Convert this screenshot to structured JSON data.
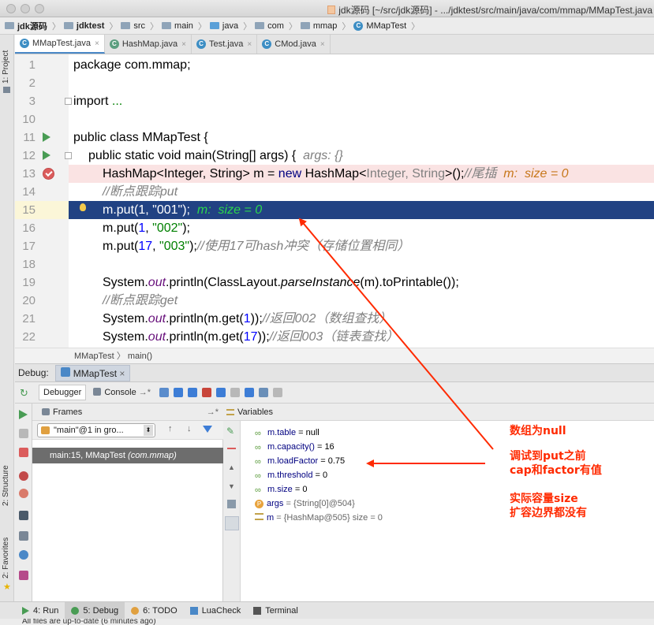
{
  "window": {
    "title": "jdk源码 [~/src/jdk源码] - .../jdktest/src/main/java/com/mmap/MMapTest.java"
  },
  "breadcrumb": {
    "items": [
      "jdk源码",
      "jdktest",
      "src",
      "main",
      "java",
      "com",
      "mmap",
      "MMapTest"
    ]
  },
  "left_stripe": {
    "project": "1: Project",
    "structure": "2: Structure",
    "favorites": "2: Favorites"
  },
  "tabs": [
    {
      "label": "MMapTest.java",
      "active": true
    },
    {
      "label": "HashMap.java",
      "active": false
    },
    {
      "label": "Test.java",
      "active": false
    },
    {
      "label": "CMod.java",
      "active": false
    }
  ],
  "editor": {
    "line_numbers": [
      "1",
      "2",
      "3",
      "10",
      "11",
      "12",
      "13",
      "14",
      "15",
      "16",
      "17",
      "18",
      "19",
      "20",
      "21",
      "22"
    ],
    "l1": "package com.mmap;",
    "l3a": "import ",
    "l3b": "...",
    "l11": "public class MMapTest {",
    "l12a": "public static void main(String[] args) {",
    "l12b": "args: {}",
    "l13a": "HashMap<Integer, String> m = ",
    "l13b": "new ",
    "l13c": "HashMap<",
    "l13d": "Integer, String",
    "l13e": ">();",
    "l13f": "//尾插",
    "l13g": "m:",
    "l13h": "size = 0",
    "l14": "//断点跟踪put",
    "l15a": "m.put(1, \"001\");",
    "l15b": "m:  size = 0",
    "l16a": "m.put(",
    "l16b": "1",
    "l16c": ", ",
    "l16d": "\"002\"",
    "l16e": ");",
    "l17a": "m.put(",
    "l17b": "17",
    "l17c": ", ",
    "l17d": "\"003\"",
    "l17e": ");",
    "l17f": "//使用17可hash冲突（存储位置相同）",
    "l19a": "System.",
    "l19b": "out",
    "l19c": ".println(ClassLayout.",
    "l19d": "parseInstance",
    "l19e": "(m).toPrintable());",
    "l20": "//断点跟踪get",
    "l21a": "System.",
    "l21b": "out",
    "l21c": ".println(m.get(",
    "l21d": "1",
    "l21e": "));",
    "l21f": "//返回002（数组查找）",
    "l22a": "System.",
    "l22b": "out",
    "l22c": ".println(m.get(",
    "l22d": "17",
    "l22e": "));",
    "l22f": "//返回003（链表查找）"
  },
  "editor_breadcrumb": {
    "cls": "MMapTest",
    "method": "main()"
  },
  "debug": {
    "label": "Debug:",
    "config": "MMapTest"
  },
  "debug_toolbar": {
    "debugger": "Debugger",
    "console": "Console"
  },
  "frames": {
    "title": "Frames",
    "thread": "\"main\"@1 in gro...",
    "frame": "main:15, MMapTest",
    "frame_pkg": "(com.mmap)"
  },
  "variables": {
    "title": "Variables",
    "rows": [
      {
        "name": "m.table",
        "value": " = null"
      },
      {
        "name": "m.capacity()",
        "value": " = 16"
      },
      {
        "name": "m.loadFactor",
        "value": " = 0.75"
      },
      {
        "name": "m.threshold",
        "value": " = 0"
      },
      {
        "name": "m.size",
        "value": " = 0"
      },
      {
        "name": "args",
        "value": " = {String[0]@504}"
      },
      {
        "name": "m",
        "value": " = {HashMap@505}  size = 0"
      }
    ]
  },
  "annotations": {
    "a1": "数组为null",
    "a2": "调试到put之前",
    "a3": "cap和factor有值",
    "a4": "实际容量size",
    "a5": "扩容边界都没有",
    "color": "#ff2a00"
  },
  "bottom": {
    "run": "4: Run",
    "debug": "5: Debug",
    "todo": "6: TODO",
    "luacheck": "LuaCheck",
    "terminal": "Terminal",
    "status": "All files are up-to-date (6 minutes ago)"
  }
}
